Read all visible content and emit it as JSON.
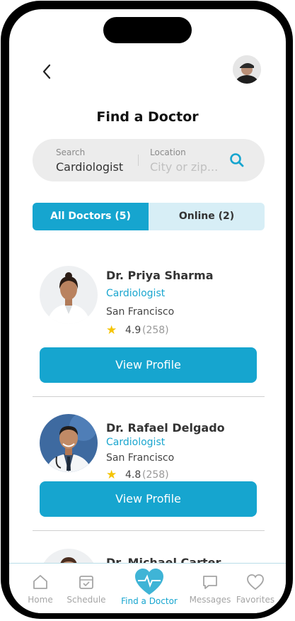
{
  "header": {
    "title": "Find a Doctor"
  },
  "search": {
    "search_label": "Search",
    "search_value": "Cardiologist",
    "location_label": "Location",
    "location_placeholder": "City or zip..."
  },
  "tabs": [
    {
      "label": "All Doctors (5)",
      "active": true
    },
    {
      "label": "Online (2)",
      "active": false
    }
  ],
  "doctors": [
    {
      "name": "Dr. Priya Sharma",
      "specialty": "Cardiologist",
      "city": "San Francisco",
      "rating": "4.9",
      "reviews": "(258)",
      "button": "View Profile"
    },
    {
      "name": "Dr. Rafael Delgado",
      "specialty": "Cardiologist",
      "city": "San Francisco",
      "rating": "4.8",
      "reviews": "(258)",
      "button": "View Profile"
    },
    {
      "name": "Dr. Michael Carter"
    }
  ],
  "nav": [
    {
      "label": "Home",
      "icon": "home-icon"
    },
    {
      "label": "Schedule",
      "icon": "calendar-icon"
    },
    {
      "label": "Find a Doctor",
      "icon": "heart-pulse-icon",
      "active": true
    },
    {
      "label": "Messages",
      "icon": "message-icon"
    },
    {
      "label": "Favorites",
      "icon": "heart-icon"
    }
  ],
  "colors": {
    "accent": "#16a5cf",
    "accent_light": "#d7eef6",
    "star": "#f5c400"
  }
}
